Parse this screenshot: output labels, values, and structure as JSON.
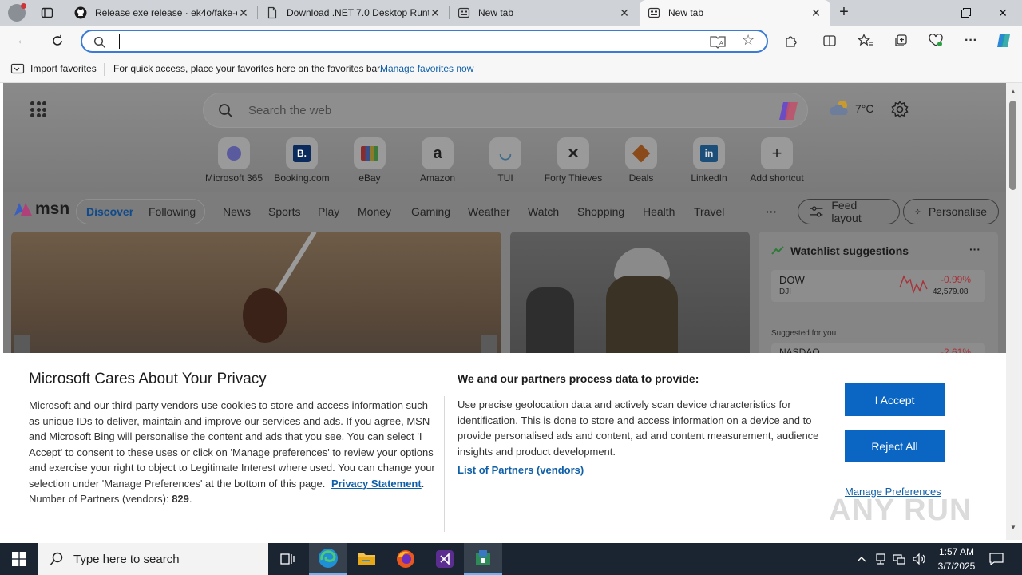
{
  "tabs": [
    {
      "label": "Release exe release · ek4o/fake-e",
      "icon": "github-icon"
    },
    {
      "label": "Download .NET 7.0 Desktop Runt",
      "icon": "page-icon"
    },
    {
      "label": "New tab",
      "icon": "newtab-icon"
    },
    {
      "label": "New tab",
      "icon": "newtab-icon",
      "active": true
    }
  ],
  "address_bar": {
    "value": "",
    "placeholder": ""
  },
  "favorites_bar": {
    "import_label": "Import favorites",
    "hint": "For quick access, place your favorites here on the favorites bar.",
    "manage_link": "Manage favorites now"
  },
  "msn": {
    "search_placeholder": "Search the web",
    "weather": "7°C",
    "shortcuts": [
      "Microsoft 365",
      "Booking.com",
      "eBay",
      "Amazon",
      "TUI",
      "Forty Thieves",
      "Deals",
      "LinkedIn",
      "Add shortcut"
    ],
    "logo": "msn",
    "feed_tabs": [
      "Discover",
      "Following"
    ],
    "nav": [
      "News",
      "Sports",
      "Play",
      "Money",
      "Gaming",
      "Weather",
      "Watch",
      "Shopping",
      "Health",
      "Travel"
    ],
    "more": "···",
    "feed_layout": "Feed layout",
    "personalise": "Personalise",
    "watchlist": {
      "title": "Watchlist suggestions",
      "more": "···",
      "stock": {
        "symbol": "DOW",
        "sub": "DJI",
        "change": "-0.99%",
        "price": "42,579.08"
      },
      "suggested": "Suggested for you",
      "peek_symbol": "NASDAQ",
      "peek_change": "-2.61%"
    }
  },
  "consent": {
    "title": "Microsoft Cares About Your Privacy",
    "body": "Microsoft and our third-party vendors use cookies to store and access information such as unique IDs to deliver, maintain and improve our services and ads. If you agree, MSN and Microsoft Bing will personalise the content and ads that you see. You can select 'I Accept' to consent to these uses or click on 'Manage preferences' to review your options and exercise your right to object to Legitimate Interest where used.  You can change your selection under 'Manage Preferences' at the bottom of this page.",
    "privacy_link": "Privacy Statement",
    "partners_label": "Number of Partners (vendors):",
    "partners_count": "829",
    "right_title": "We and our partners process data to provide:",
    "right_body": "Use precise geolocation data and actively scan device characteristics for identification. This is done to store and access information on a device and to provide personalised ads and content, ad and content measurement, audience insights and product development.",
    "list_link": "List of Partners (vendors)",
    "accept": "I Accept",
    "reject": "Reject All",
    "manage": "Manage Preferences"
  },
  "watermark": "ANY RUN",
  "taskbar": {
    "search_placeholder": "Type here to search",
    "time": "1:57 AM",
    "date": "3/7/2025"
  },
  "colors": {
    "accent": "#0a66c2",
    "link": "#0f5fa8",
    "taskbar": "#1b2431",
    "negative": "#c4262e"
  }
}
